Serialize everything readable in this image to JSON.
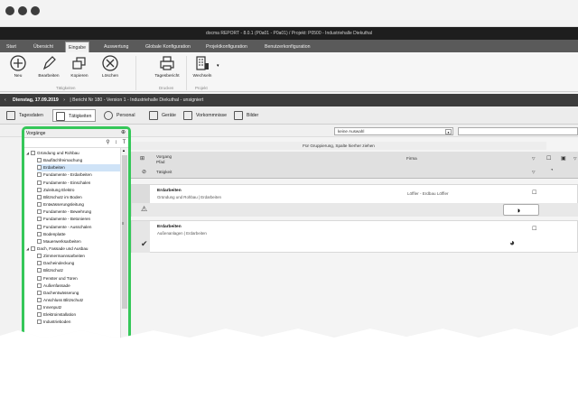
{
  "window": {
    "app_title": "docma REPORT - 8.0.1 (P0a01 - P0a01) / Projekt: P0500 - Industriehalle Diekuthal"
  },
  "menu": {
    "tabs": [
      "Start",
      "Übersicht",
      "Eingabe",
      "Auswertung",
      "Globale Konfiguration",
      "Projektkonfiguration",
      "Benutzerkonfiguration"
    ],
    "active": "Eingabe"
  },
  "ribbon": {
    "buttons": [
      "Neu",
      "Bearbeiten",
      "Kopieren",
      "Löschen",
      "Tagesbericht",
      "Wechseln"
    ],
    "groups": [
      "Tätigkeiten",
      "Drucken",
      "Projekt"
    ]
  },
  "datebar": {
    "date": "Dienstag, 17.09.2019",
    "report": "| Bericht Nr 180 - Version 1 - Industriehalle Diekuthal - unsigniert"
  },
  "tabs": {
    "items": [
      "Tagesdaten",
      "Tätigkeiten",
      "Personal",
      "Geräte",
      "Vorkommnisse",
      "Bilder"
    ],
    "active": "Tätigkeiten"
  },
  "filter": {
    "selected": "keine Auswahl"
  },
  "panel": {
    "title": "Vorgänge",
    "tree": [
      {
        "label": "Gründung und Rohbau",
        "level": 0
      },
      {
        "label": "Bauflächfreimachung",
        "level": 1
      },
      {
        "label": "Erdarbeiten",
        "level": 1,
        "selected": true
      },
      {
        "label": "Fundamente - Erdarbeiten",
        "level": 1
      },
      {
        "label": "Fundamente - Einschalen",
        "level": 1
      },
      {
        "label": "Zuleitung Elektro",
        "level": 1
      },
      {
        "label": "Blitzschutz im Boden",
        "level": 1
      },
      {
        "label": "Entwässerungsleitung",
        "level": 1
      },
      {
        "label": "Fundamente - Bewehrung",
        "level": 1
      },
      {
        "label": "Fundamente - Betonieren",
        "level": 1
      },
      {
        "label": "Fundamente - Ausschalen",
        "level": 1
      },
      {
        "label": "Bodenplatte",
        "level": 1
      },
      {
        "label": "Mauerwerksarbeiten",
        "level": 1
      },
      {
        "label": "Dach, Fassade und Ausbau",
        "level": 0
      },
      {
        "label": "Zimmermannsarbeiten",
        "level": 1
      },
      {
        "label": "Dacheindeckung",
        "level": 1
      },
      {
        "label": "Blitzschutz",
        "level": 1
      },
      {
        "label": "Fenster und Türen",
        "level": 1
      },
      {
        "label": "Außenfassade",
        "level": 1
      },
      {
        "label": "Dachentwässerung",
        "level": 1
      },
      {
        "label": "Anschluss Blitzschutz",
        "level": 1
      },
      {
        "label": "Innenputz",
        "level": 1
      },
      {
        "label": "Elektroinstallation",
        "level": 1
      },
      {
        "label": "Industrieboden",
        "level": 1
      }
    ]
  },
  "grid": {
    "group_hint": "Für Gruppierung, Spalte hierher ziehen",
    "headers": {
      "vorgang": "Vorgang",
      "pfad": "Pfad",
      "firma": "Firma",
      "taetigkeit": "Tätigkeit"
    },
    "rows": [
      {
        "title": "Erdarbeiten",
        "path": "Gründung und Rohbau | Erdarbeiten",
        "firm": "Löffler - Erdbau Löffler",
        "status": "warning"
      },
      {
        "title": "Erdarbeiten",
        "path": "Außenanlagen | Erdarbeiten",
        "firm": "Löffler - Erdbau Löffler",
        "status": "done"
      }
    ]
  }
}
